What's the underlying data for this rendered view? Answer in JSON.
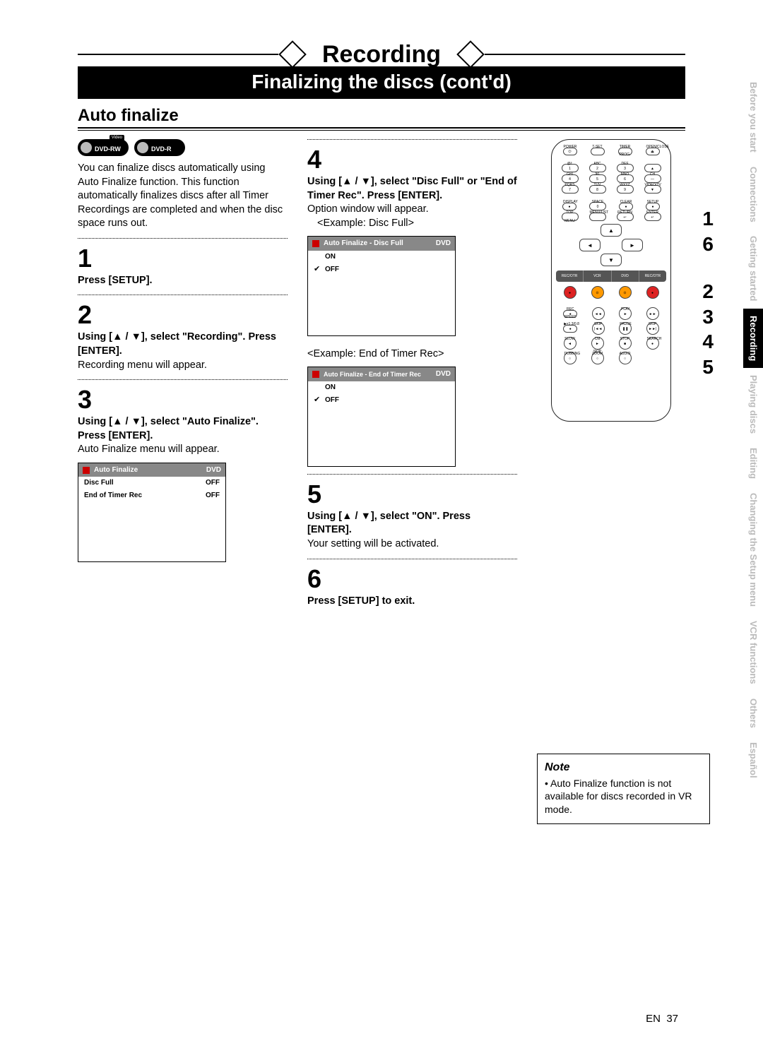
{
  "header": {
    "main_title": "Recording",
    "sub_title": "Finalizing the discs (cont'd)",
    "section_heading": "Auto finalize"
  },
  "badges": {
    "b1": "DVD-RW",
    "b1_tag": "Video",
    "b2": "DVD-R"
  },
  "intro_text": "You can finalize discs automatically using Auto Finalize function. This function automatically finalizes discs after all Timer Recordings are completed and when the disc space runs out.",
  "steps": {
    "s1_num": "1",
    "s1_bold": "Press [SETUP].",
    "s2_num": "2",
    "s2_bold": "Using [▲ / ▼], select \"Recording\". Press [ENTER].",
    "s2_text": "Recording menu will appear.",
    "s3_num": "3",
    "s3_bold": "Using [▲ / ▼], select \"Auto Finalize\". Press [ENTER].",
    "s3_text": "Auto Finalize menu will appear.",
    "s4_num": "4",
    "s4_bold": "Using [▲ / ▼], select \"Disc Full\" or \"End of Timer Rec\". Press [ENTER].",
    "s4_text": "Option window will appear.",
    "s4_caption1": "<Example: Disc Full>",
    "s4_caption2": "<Example: End of Timer Rec>",
    "s5_num": "5",
    "s5_bold": "Using [▲ / ▼], select \"ON\". Press [ENTER].",
    "s5_text": "Your setting will be activated.",
    "s6_num": "6",
    "s6_bold": "Press [SETUP] to exit."
  },
  "osd1": {
    "title": "Auto Finalize",
    "dvd": "DVD",
    "rows": [
      {
        "label": "Disc Full",
        "val": "OFF"
      },
      {
        "label": "End of Timer Rec",
        "val": "OFF"
      }
    ]
  },
  "osd2": {
    "title": "Auto Finalize - Disc Full",
    "dvd": "DVD",
    "rows": [
      {
        "chk": "",
        "label": "ON"
      },
      {
        "chk": "✔",
        "label": "OFF"
      }
    ]
  },
  "osd3": {
    "title": "Auto Finalize - End of Timer Rec",
    "dvd": "DVD",
    "rows": [
      {
        "chk": "",
        "label": "ON"
      },
      {
        "chk": "✔",
        "label": "OFF"
      }
    ]
  },
  "remote": {
    "top_labels": [
      "POWER",
      "T-SET",
      "TIMER PROG.",
      "OPEN/CLOSE"
    ],
    "num_labels": [
      [
        "@/:",
        "ABC",
        "DEF",
        ""
      ],
      [
        "GHI",
        "JKL",
        "MNO",
        "CH"
      ],
      [
        "PQRS",
        "TUV",
        "WXYZ",
        "VIDEO/TV"
      ]
    ],
    "numbers": [
      [
        "1",
        "2",
        "3",
        "▲"
      ],
      [
        "4",
        "5",
        "6",
        "—"
      ],
      [
        "7",
        "8",
        "9",
        "▼"
      ]
    ],
    "row4_labels": [
      "DISPLAY",
      "SPACE",
      "CLEAR",
      "SETUP"
    ],
    "row4_nums": [
      "●",
      "0",
      "●",
      "●"
    ],
    "row5_labels": [
      "TOP MENU",
      "MENU/LIST",
      "RETURN",
      "ENTER"
    ],
    "dpad": {
      "up": "▲",
      "down": "▼",
      "left": "◄",
      "right": "►"
    },
    "mode_bar": [
      "REC/OTR",
      "VCR",
      "DVD",
      "REC/OTR"
    ],
    "mode_row": [
      "●",
      "⊙",
      "⊙",
      "●"
    ],
    "row_rs_labels": [
      "REC SPEED",
      "",
      "PLAY",
      ""
    ],
    "row_rs": [
      "●",
      "◄◄",
      "►",
      "►►"
    ],
    "row_sk_labels": [
      "▶x1.3/0.8",
      "SKIP",
      "PAUSE",
      "SKIP"
    ],
    "row_sk": [
      "●",
      "|◄◄",
      "❚❚",
      "►►|"
    ],
    "row_sl_labels": [
      "SLOW",
      "CM SKIP",
      "STOP",
      "SEARCH"
    ],
    "row_sl": [
      "◄",
      "►",
      "■",
      "●"
    ],
    "row_db_labels": [
      "DUBBING",
      "ZOOM",
      "AUDIO",
      ""
    ],
    "row_db": [
      "○",
      "○",
      "○",
      ""
    ]
  },
  "callouts": [
    "1",
    "6",
    "2",
    "3",
    "4",
    "5"
  ],
  "tabs": [
    {
      "label": "Before you start",
      "active": false
    },
    {
      "label": "Connections",
      "active": false
    },
    {
      "label": "Getting started",
      "active": false
    },
    {
      "label": "Recording",
      "active": true
    },
    {
      "label": "Playing discs",
      "active": false
    },
    {
      "label": "Editing",
      "active": false
    },
    {
      "label": "Changing the Setup menu",
      "active": false,
      "stacked": true
    },
    {
      "label": "VCR functions",
      "active": false
    },
    {
      "label": "Others",
      "active": false
    },
    {
      "label": "Español",
      "active": false
    }
  ],
  "note": {
    "title": "Note",
    "text": "• Auto Finalize function is not available for discs recorded in VR mode."
  },
  "page_num_prefix": "EN",
  "page_num": "37"
}
